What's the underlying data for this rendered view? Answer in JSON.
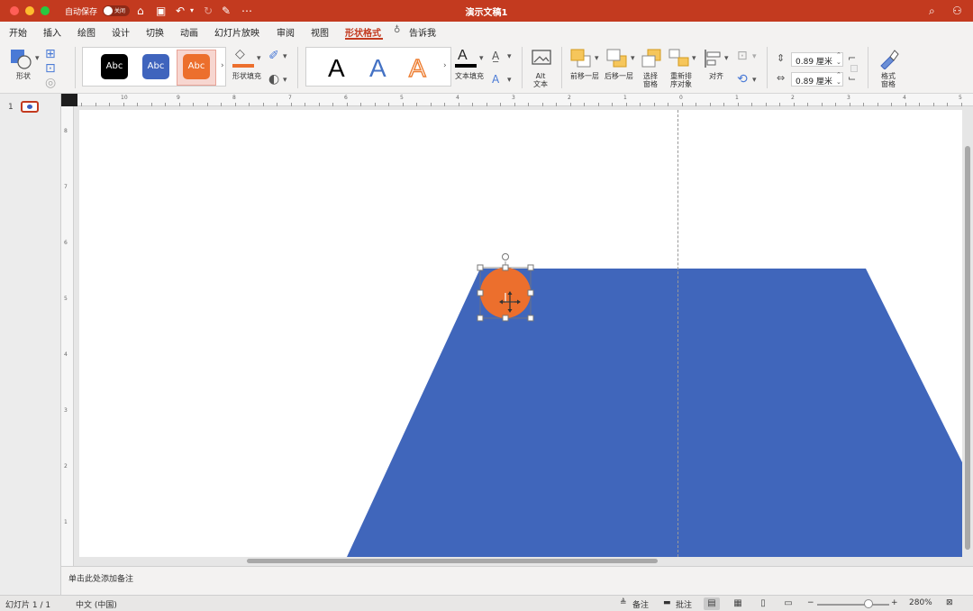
{
  "titlebar": {
    "autosave_label": "自动保存",
    "autosave_state": "关闭",
    "doc_title": "演示文稿1",
    "quick_icons": [
      "home-icon",
      "save-icon",
      "undo-icon",
      "redo-icon",
      "edit-icon",
      "more-icon"
    ],
    "right_icons": [
      "search-icon",
      "share-person-icon"
    ]
  },
  "tabs": [
    {
      "label": "开始"
    },
    {
      "label": "插入"
    },
    {
      "label": "绘图"
    },
    {
      "label": "设计"
    },
    {
      "label": "切换"
    },
    {
      "label": "动画"
    },
    {
      "label": "幻灯片放映"
    },
    {
      "label": "审阅"
    },
    {
      "label": "视图"
    },
    {
      "label": "形状格式",
      "active": true
    },
    {
      "label": "告诉我"
    }
  ],
  "actions": {
    "share": "共享",
    "comment": "批注"
  },
  "ribbon": {
    "shapes_label": "形状",
    "shape_styles": [
      {
        "text": "Abc",
        "color": "#000000"
      },
      {
        "text": "Abc",
        "color": "#3f64bd"
      },
      {
        "text": "Abc",
        "color": "#ec6f2d",
        "selected": true
      }
    ],
    "shape_fill_label": "形状填充",
    "shape_fill_color": "#ec6f2d",
    "wordart": [
      {
        "text": "A",
        "color": "#000000"
      },
      {
        "text": "A",
        "color": "#4472c4"
      },
      {
        "text": "A",
        "color": "#ed7d31"
      }
    ],
    "text_fill_label": "文本填充",
    "alt_text_label": [
      "Alt",
      "文本"
    ],
    "bring_forward_label": "前移一层",
    "send_backward_label": "后移一层",
    "selection_pane_label": [
      "选择",
      "窗格"
    ],
    "reorder_label": [
      "重新排",
      "序对象"
    ],
    "align_label": "对齐",
    "height_value": "0.89 厘米",
    "width_value": "0.89 厘米",
    "format_pane_label": [
      "格式",
      "窗格"
    ]
  },
  "ruler": {
    "h_ticks": [
      "10",
      "9",
      "8",
      "7",
      "6",
      "5",
      "4",
      "3",
      "2",
      "1",
      "0",
      "1",
      "2",
      "3",
      "4",
      "5"
    ],
    "v_ticks": [
      "8",
      "7",
      "6",
      "5",
      "4",
      "3",
      "2",
      "1"
    ]
  },
  "slide_panel": {
    "number": "1"
  },
  "canvas": {
    "trapezoid_color": "#4066bb",
    "circle_color": "#ec6f2d"
  },
  "notes_placeholder": "单击此处添加备注",
  "status": {
    "slide_info": "幻灯片 1 / 1",
    "language": "中文 (中国)",
    "notes_label": "备注",
    "comments_label": "批注",
    "zoom": "280%"
  }
}
